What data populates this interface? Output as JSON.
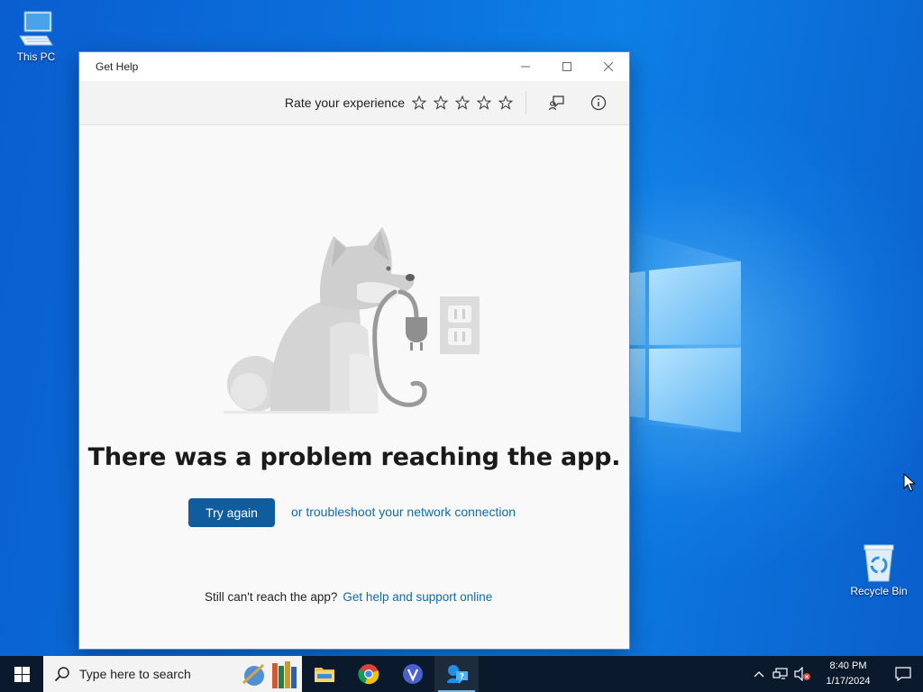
{
  "desktop": {
    "icons": [
      {
        "label": "This PC"
      },
      {
        "label": "Recycle Bin"
      }
    ]
  },
  "window": {
    "title": "Get Help",
    "toolbar": {
      "rate_label": "Rate your experience",
      "star_count": 5
    },
    "error": {
      "message": "There was a problem reaching the app.",
      "try_again_label": "Try again",
      "troubleshoot_link": "or troubleshoot your network connection",
      "still_text": "Still can't reach the app?",
      "support_link": "Get help and support online"
    }
  },
  "taskbar": {
    "search_placeholder": "Type here to search",
    "apps": [
      "file-explorer",
      "chrome",
      "v-app",
      "get-help"
    ],
    "clock": {
      "time": "8:40 PM",
      "date": "1/17/2024"
    }
  },
  "colors": {
    "accent_button": "#0f5c9e",
    "link": "#0f6aa8",
    "taskbar": "#0a1a2c"
  }
}
